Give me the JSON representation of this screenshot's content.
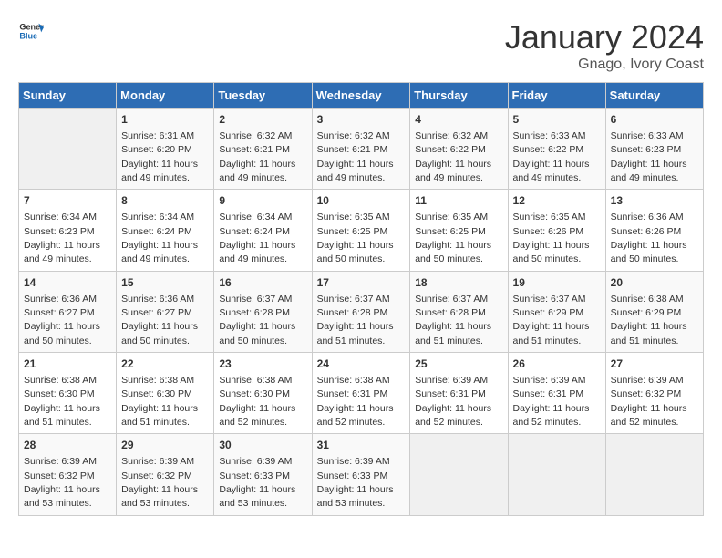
{
  "header": {
    "logo_line1": "General",
    "logo_line2": "Blue",
    "month_year": "January 2024",
    "location": "Gnago, Ivory Coast"
  },
  "weekdays": [
    "Sunday",
    "Monday",
    "Tuesday",
    "Wednesday",
    "Thursday",
    "Friday",
    "Saturday"
  ],
  "weeks": [
    [
      {
        "day": "",
        "sunrise": "",
        "sunset": "",
        "daylight": ""
      },
      {
        "day": "1",
        "sunrise": "6:31 AM",
        "sunset": "6:20 PM",
        "daylight": "11 hours and 49 minutes."
      },
      {
        "day": "2",
        "sunrise": "6:32 AM",
        "sunset": "6:21 PM",
        "daylight": "11 hours and 49 minutes."
      },
      {
        "day": "3",
        "sunrise": "6:32 AM",
        "sunset": "6:21 PM",
        "daylight": "11 hours and 49 minutes."
      },
      {
        "day": "4",
        "sunrise": "6:32 AM",
        "sunset": "6:22 PM",
        "daylight": "11 hours and 49 minutes."
      },
      {
        "day": "5",
        "sunrise": "6:33 AM",
        "sunset": "6:22 PM",
        "daylight": "11 hours and 49 minutes."
      },
      {
        "day": "6",
        "sunrise": "6:33 AM",
        "sunset": "6:23 PM",
        "daylight": "11 hours and 49 minutes."
      }
    ],
    [
      {
        "day": "7",
        "sunrise": "6:34 AM",
        "sunset": "6:23 PM",
        "daylight": "11 hours and 49 minutes."
      },
      {
        "day": "8",
        "sunrise": "6:34 AM",
        "sunset": "6:24 PM",
        "daylight": "11 hours and 49 minutes."
      },
      {
        "day": "9",
        "sunrise": "6:34 AM",
        "sunset": "6:24 PM",
        "daylight": "11 hours and 49 minutes."
      },
      {
        "day": "10",
        "sunrise": "6:35 AM",
        "sunset": "6:25 PM",
        "daylight": "11 hours and 50 minutes."
      },
      {
        "day": "11",
        "sunrise": "6:35 AM",
        "sunset": "6:25 PM",
        "daylight": "11 hours and 50 minutes."
      },
      {
        "day": "12",
        "sunrise": "6:35 AM",
        "sunset": "6:26 PM",
        "daylight": "11 hours and 50 minutes."
      },
      {
        "day": "13",
        "sunrise": "6:36 AM",
        "sunset": "6:26 PM",
        "daylight": "11 hours and 50 minutes."
      }
    ],
    [
      {
        "day": "14",
        "sunrise": "6:36 AM",
        "sunset": "6:27 PM",
        "daylight": "11 hours and 50 minutes."
      },
      {
        "day": "15",
        "sunrise": "6:36 AM",
        "sunset": "6:27 PM",
        "daylight": "11 hours and 50 minutes."
      },
      {
        "day": "16",
        "sunrise": "6:37 AM",
        "sunset": "6:28 PM",
        "daylight": "11 hours and 50 minutes."
      },
      {
        "day": "17",
        "sunrise": "6:37 AM",
        "sunset": "6:28 PM",
        "daylight": "11 hours and 51 minutes."
      },
      {
        "day": "18",
        "sunrise": "6:37 AM",
        "sunset": "6:28 PM",
        "daylight": "11 hours and 51 minutes."
      },
      {
        "day": "19",
        "sunrise": "6:37 AM",
        "sunset": "6:29 PM",
        "daylight": "11 hours and 51 minutes."
      },
      {
        "day": "20",
        "sunrise": "6:38 AM",
        "sunset": "6:29 PM",
        "daylight": "11 hours and 51 minutes."
      }
    ],
    [
      {
        "day": "21",
        "sunrise": "6:38 AM",
        "sunset": "6:30 PM",
        "daylight": "11 hours and 51 minutes."
      },
      {
        "day": "22",
        "sunrise": "6:38 AM",
        "sunset": "6:30 PM",
        "daylight": "11 hours and 51 minutes."
      },
      {
        "day": "23",
        "sunrise": "6:38 AM",
        "sunset": "6:30 PM",
        "daylight": "11 hours and 52 minutes."
      },
      {
        "day": "24",
        "sunrise": "6:38 AM",
        "sunset": "6:31 PM",
        "daylight": "11 hours and 52 minutes."
      },
      {
        "day": "25",
        "sunrise": "6:39 AM",
        "sunset": "6:31 PM",
        "daylight": "11 hours and 52 minutes."
      },
      {
        "day": "26",
        "sunrise": "6:39 AM",
        "sunset": "6:31 PM",
        "daylight": "11 hours and 52 minutes."
      },
      {
        "day": "27",
        "sunrise": "6:39 AM",
        "sunset": "6:32 PM",
        "daylight": "11 hours and 52 minutes."
      }
    ],
    [
      {
        "day": "28",
        "sunrise": "6:39 AM",
        "sunset": "6:32 PM",
        "daylight": "11 hours and 53 minutes."
      },
      {
        "day": "29",
        "sunrise": "6:39 AM",
        "sunset": "6:32 PM",
        "daylight": "11 hours and 53 minutes."
      },
      {
        "day": "30",
        "sunrise": "6:39 AM",
        "sunset": "6:33 PM",
        "daylight": "11 hours and 53 minutes."
      },
      {
        "day": "31",
        "sunrise": "6:39 AM",
        "sunset": "6:33 PM",
        "daylight": "11 hours and 53 minutes."
      },
      {
        "day": "",
        "sunrise": "",
        "sunset": "",
        "daylight": ""
      },
      {
        "day": "",
        "sunrise": "",
        "sunset": "",
        "daylight": ""
      },
      {
        "day": "",
        "sunrise": "",
        "sunset": "",
        "daylight": ""
      }
    ]
  ]
}
